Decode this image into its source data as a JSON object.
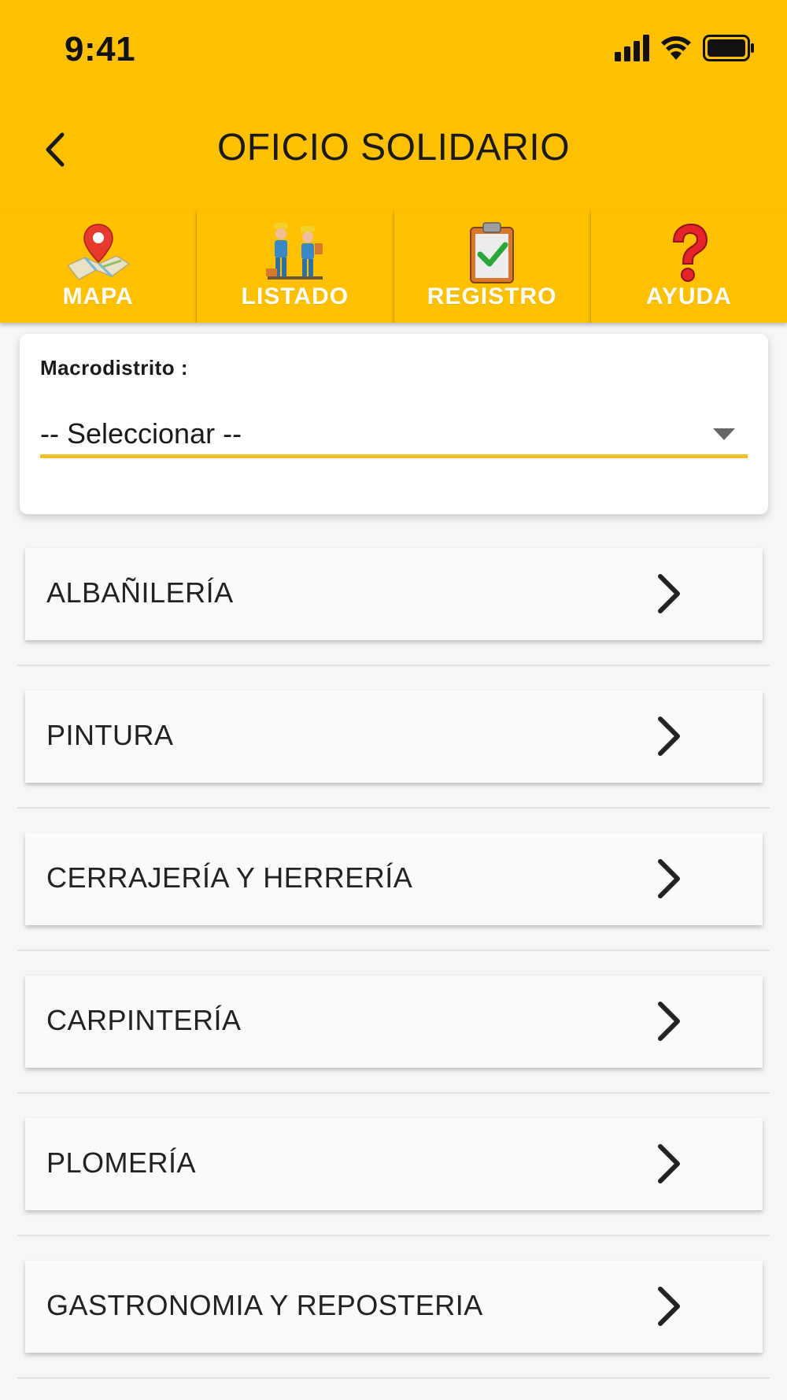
{
  "status_bar": {
    "time": "9:41"
  },
  "header": {
    "title": "OFICIO SOLIDARIO",
    "back_icon": "chevron-left-icon"
  },
  "colors": {
    "primary": "#ffc000",
    "underline": "#f3c121",
    "tab_text": "#ffffff"
  },
  "tabs": [
    {
      "label": "MAPA",
      "icon": "map-pin-icon"
    },
    {
      "label": "LISTADO",
      "icon": "workers-icon"
    },
    {
      "label": "REGISTRO",
      "icon": "clipboard-check-icon"
    },
    {
      "label": "AYUDA",
      "icon": "question-mark-icon"
    }
  ],
  "filter": {
    "label": "Macrodistrito :",
    "selected": "-- Seleccionar --"
  },
  "categories": [
    {
      "label": "ALBAÑILERÍA"
    },
    {
      "label": "PINTURA"
    },
    {
      "label": "CERRAJERÍA Y HERRERÍA"
    },
    {
      "label": "CARPINTERÍA"
    },
    {
      "label": "PLOMERÍA"
    },
    {
      "label": "GASTRONOMIA Y REPOSTERIA"
    }
  ]
}
